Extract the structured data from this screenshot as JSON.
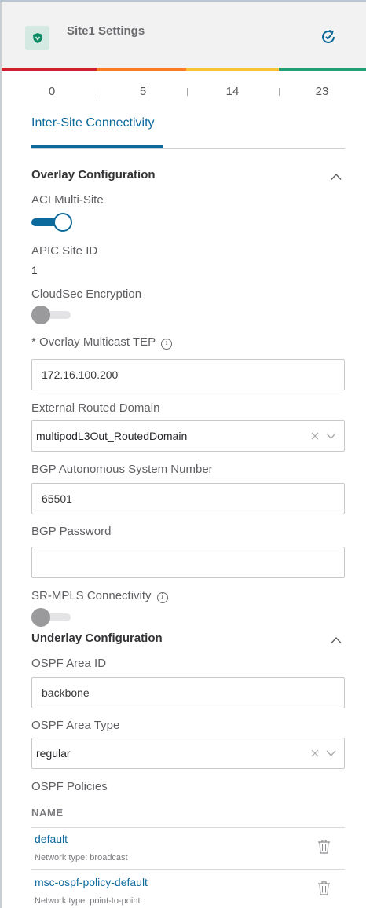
{
  "header": {
    "title": "Site1 Settings",
    "logo_icon": "shield-icon",
    "refresh_icon": "refresh-check-icon"
  },
  "health": {
    "colors": [
      "#cf2030",
      "#fb7b22",
      "#f9c236",
      "#21a078"
    ],
    "counts": [
      "0",
      "5",
      "14",
      "23"
    ]
  },
  "tabs": [
    {
      "label": "Inter-Site Connectivity",
      "active": true
    }
  ],
  "overlay": {
    "title": "Overlay Configuration",
    "aci_multisite_label": "ACI Multi-Site",
    "aci_multisite_enabled": true,
    "apic_site_id_label": "APIC Site ID",
    "apic_site_id_value": "1",
    "cloudsec_label": "CloudSec Encryption",
    "cloudsec_enabled": false,
    "multicast_tep_label": "* Overlay Multicast TEP",
    "multicast_tep_value": "172.16.100.200",
    "external_routed_domain_label": "External Routed Domain",
    "external_routed_domain_value": "multipodL3Out_RoutedDomain",
    "bgp_asn_label": "BGP Autonomous System Number",
    "bgp_asn_value": "65501",
    "bgp_password_label": "BGP Password",
    "bgp_password_value": "",
    "sr_mpls_label": "SR-MPLS Connectivity",
    "sr_mpls_enabled": false
  },
  "underlay": {
    "title": "Underlay Configuration",
    "ospf_area_id_label": "OSPF Area ID",
    "ospf_area_id_value": "backbone",
    "ospf_area_type_label": "OSPF Area Type",
    "ospf_area_type_value": "regular",
    "ospf_policies_label": "OSPF Policies",
    "policies_column": "NAME",
    "policies": [
      {
        "name": "default",
        "network_type": "Network type: broadcast"
      },
      {
        "name": "msc-ospf-policy-default",
        "network_type": "Network type: point-to-point"
      }
    ]
  },
  "info_glyph": "i"
}
